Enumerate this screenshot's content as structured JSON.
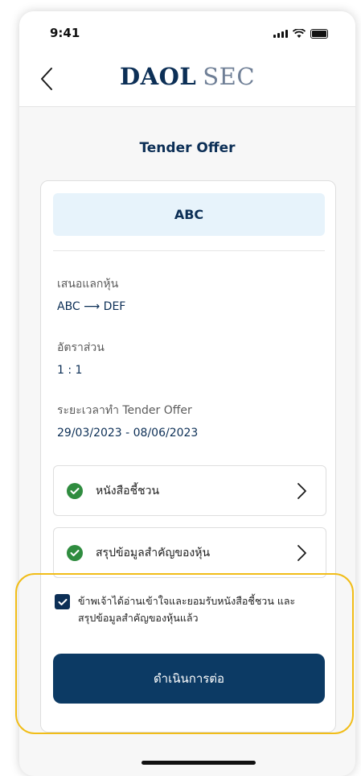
{
  "status_bar": {
    "time": "9:41"
  },
  "header": {
    "brand_part1": "DAOL",
    "brand_part2": "SEC"
  },
  "page": {
    "title": "Tender Offer"
  },
  "stock": {
    "symbol": "ABC"
  },
  "info": [
    {
      "label": "เสนอแลกหุ้น",
      "value": "ABC ⟶ DEF"
    },
    {
      "label": "อัตราส่วน",
      "value": "1 : 1"
    },
    {
      "label": "ระยะเวลาทำ Tender Offer",
      "value": "29/03/2023 - 08/06/2023"
    }
  ],
  "documents": [
    {
      "label": "หนังสือชี้ชวน"
    },
    {
      "label": "สรุปข้อมูลสำคัญของหุ้น"
    }
  ],
  "agreement": {
    "line1": "ข้าพเจ้าได้อ่านเข้าใจและยอมรับหนังสือชี้ชวน และ",
    "line2": "สรุปข้อมูลสำคัญของหุ้นแล้ว"
  },
  "actions": {
    "continue_label": "ดำเนินการต่อ"
  },
  "colors": {
    "primary": "#0c3a64",
    "success": "#2f8c3f",
    "highlight": "#f1bd18",
    "stock_bg": "#e7f3fb"
  }
}
